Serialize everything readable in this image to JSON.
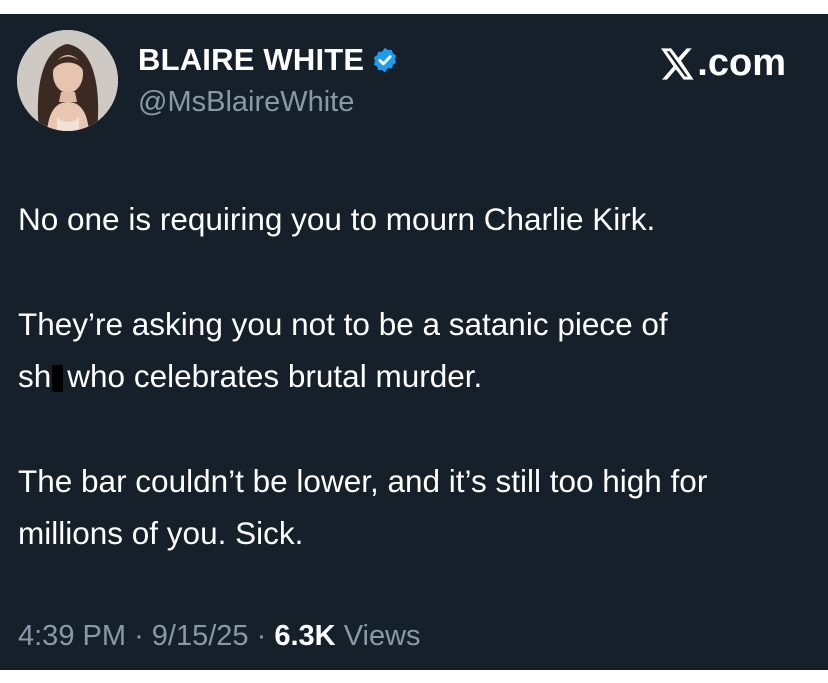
{
  "author": {
    "name": "BLAIRE WHITE",
    "handle": "@MsBlaireWhite",
    "verified": true,
    "avatar_icon": "profile-photo"
  },
  "brand": {
    "logo_icon": "x-logo-icon",
    "label": ".com"
  },
  "tweet": {
    "paragraphs": [
      "No one is requiring you to mourn Charlie Kirk.",
      "They’re asking you not to be a satanic piece of",
      "sh",
      "who celebrates brutal murder.",
      "The bar couldn’t be lower, and it’s still too high for millions of you. Sick."
    ]
  },
  "meta": {
    "time": "4:39 PM",
    "separator": "·",
    "date": "9/15/25",
    "views_count": "6.3K",
    "views_label": "Views"
  },
  "colors": {
    "background": "#15202b",
    "text": "#ffffff",
    "muted": "#8b98a5",
    "verified": "#1d9bf0"
  }
}
